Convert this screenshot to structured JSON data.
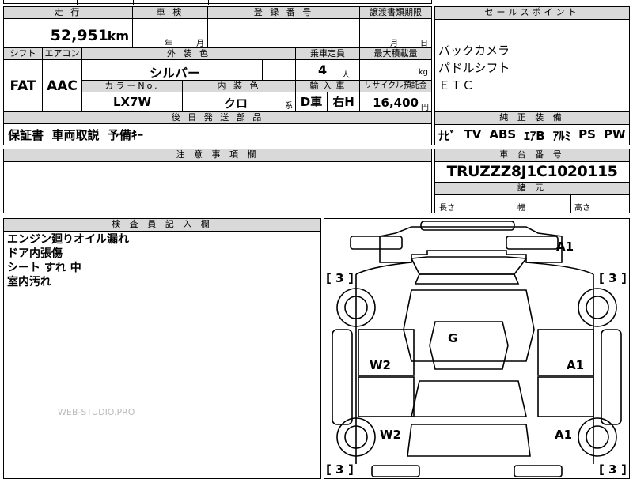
{
  "top_row": {
    "cells": [
      "",
      "",
      "",
      ""
    ]
  },
  "vehicle_table": {
    "mileage_label": "走 行",
    "mileage_value": "52,951",
    "mileage_unit": "km",
    "inspection_label": "車 検",
    "inspection_year_unit": "年",
    "inspection_month_unit": "月",
    "registration_label": "登 録 番 号",
    "registration_value": "",
    "transfer_docs_label": "譲渡書類期限",
    "transfer_month_unit": "月",
    "transfer_day_unit": "日",
    "shift_label": "シフト",
    "shift_value": "FAT",
    "ac_label": "エアコン",
    "ac_value": "AAC",
    "exterior_color_label": "外 装 色",
    "exterior_color_value": "シルバー",
    "color_no_label": "カラーNo.",
    "color_no_value": "LX7W",
    "interior_color_label": "内 装 色",
    "interior_color_value": "クロ",
    "interior_color_suffix": "系",
    "capacity_label": "乗車定員",
    "capacity_value": "4",
    "capacity_unit": "人",
    "max_load_label": "最大積載量",
    "max_load_value": "",
    "max_load_unit": "kg",
    "import_label": "輸 入 車",
    "import_d": "D車",
    "import_steer": "右H",
    "recycle_label": "リサイクル預託金",
    "recycle_value": "16,400",
    "recycle_unit": "円",
    "later_parts_label": "後 日 発 送 部 品",
    "later_parts_value": "保証書  車両取説  予備ｷｰ",
    "notes_label": "注 意 事 項 欄",
    "notes_value": ""
  },
  "sales_points": {
    "label": "セールスポイント",
    "items": [
      "バックカメラ",
      "パドルシフト",
      "ＥＴＣ"
    ]
  },
  "standard_equipment": {
    "label": "純 正 装 備",
    "items": [
      "ﾅﾋﾞ",
      "TV",
      "ABS",
      "ｴｱB",
      "ｱﾙﾐ",
      "PS",
      "PW"
    ]
  },
  "chassis": {
    "label": "車 台 番 号",
    "value": "TRUZZZ8J1C1020115"
  },
  "dimensions": {
    "label": "諸 元",
    "length": "長さ",
    "width": "幅",
    "height": "高さ"
  },
  "inspector": {
    "label": "検 査 員 記 入 欄",
    "lines": [
      "エンジン廻りオイル漏れ",
      "ドア内張傷",
      "シート すれ 中",
      "室内汚れ"
    ]
  },
  "watermark": "WEB-STUDIO.PRO",
  "diagram": {
    "marks": {
      "front_right": "A1",
      "left_front_door": "W2",
      "right_front_door": "A1",
      "left_rear_door": "W2",
      "right_rear_door": "A1",
      "roof": "G"
    },
    "tire_tl": "3",
    "tire_tr": "3",
    "tire_bl": "3",
    "tire_br": "3"
  }
}
